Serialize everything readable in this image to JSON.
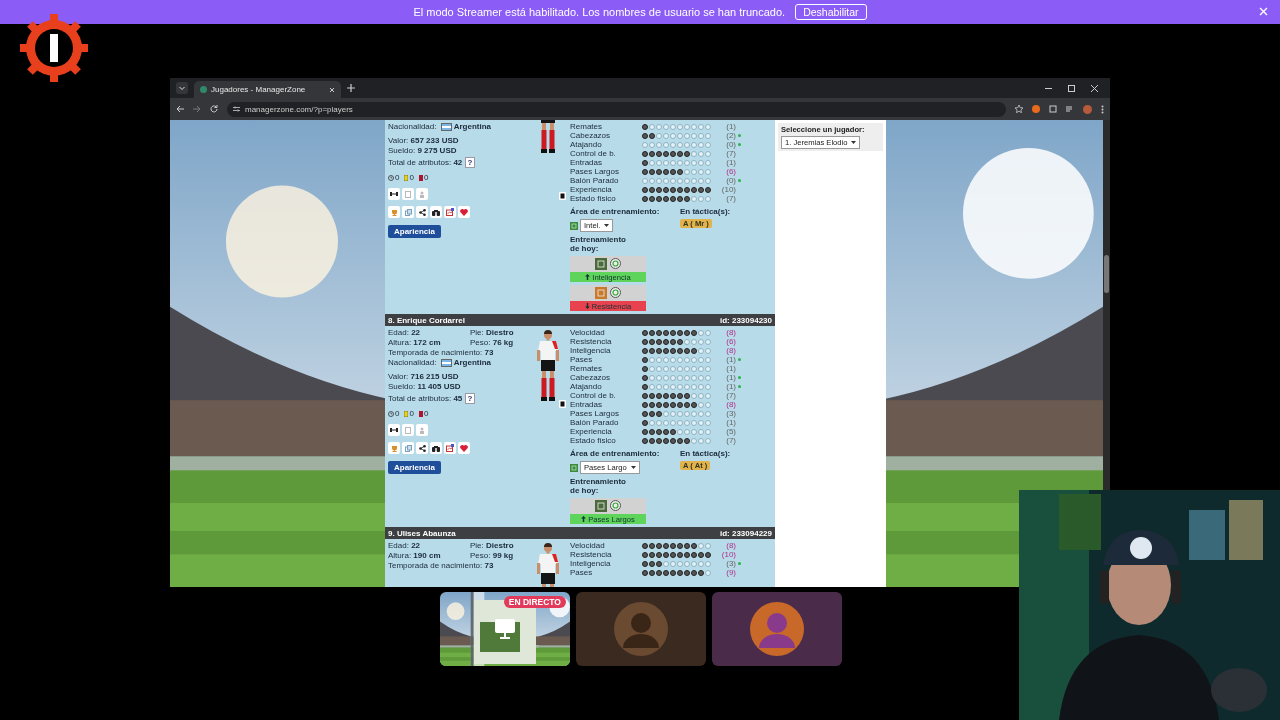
{
  "banner": {
    "text": "El modo Streamer está habilitado. Los nombres de usuario se han truncado.",
    "button": "Deshabilitar"
  },
  "browser": {
    "tab_title": "Jugadores - ManagerZone",
    "url": "managerzone.com/?p=players"
  },
  "players": [
    {
      "info_rows": [
        [
          {
            "label": "Nacionalidad:",
            "value": "Argentina",
            "flag": true
          }
        ]
      ],
      "money_rows": [
        {
          "label": "Valor:",
          "value": "657 233 USD"
        },
        {
          "label": "Sueldo:",
          "value": "9 275 USD"
        }
      ],
      "total": {
        "label": "Total de atributos:",
        "value": "42",
        "help": "?"
      },
      "cards": [
        {
          "kind": "clock",
          "count": "0"
        },
        {
          "kind": "yellow",
          "count": "0"
        },
        {
          "kind": "red",
          "count": "0"
        }
      ],
      "appearance_button": "Apariencia",
      "skills": [
        {
          "name": "Remates",
          "stars": 1,
          "value": "(1)",
          "maxed": false,
          "dot": false
        },
        {
          "name": "Cabezazos",
          "stars": 2,
          "value": "(2)",
          "maxed": false,
          "dot": true
        },
        {
          "name": "Atajando",
          "stars": 0,
          "value": "(0)",
          "maxed": false,
          "dot": true
        },
        {
          "name": "Control de b.",
          "stars": 7,
          "value": "(7)",
          "maxed": false,
          "dot": false
        },
        {
          "name": "Entradas",
          "stars": 1,
          "value": "(1)",
          "maxed": false,
          "dot": false
        },
        {
          "name": "Pases Largos",
          "stars": 6,
          "value": "(6)",
          "maxed": true,
          "dot": false
        },
        {
          "name": "Balón Parado",
          "stars": 0,
          "value": "(0)",
          "maxed": false,
          "dot": true
        },
        {
          "name": "Experiencia",
          "stars": 10,
          "value": "(10)",
          "maxed": false,
          "dot": false
        },
        {
          "name": "Estado físico",
          "stars": 7,
          "value": "(7)",
          "maxed": false,
          "dot": false
        }
      ],
      "training": {
        "area_label": "Área de entrenamiento:",
        "area": "Intel.",
        "tactics_label": "En táctica(s):",
        "tactic": "A ( Mr )",
        "today_label": "Entrenamiento de hoy:",
        "today": [
          {
            "skill": "Inteligencia",
            "kind": "up"
          },
          {
            "skill": "Resistencia",
            "kind": "down"
          }
        ]
      }
    },
    {
      "header": {
        "name": "8. Enrique Cordarrel",
        "id": "id: 233094230"
      },
      "info_rows": [
        [
          {
            "label": "Edad:",
            "value": "22"
          },
          {
            "label": "Pie:",
            "value": "Diestro"
          }
        ],
        [
          {
            "label": "Altura:",
            "value": "172 cm"
          },
          {
            "label": "Peso:",
            "value": "76 kg"
          }
        ],
        [
          {
            "label": "Temporada de nacimiento:",
            "value": "73"
          }
        ],
        [
          {
            "label": "Nacionalidad:",
            "value": "Argentina",
            "flag": true
          }
        ]
      ],
      "money_rows": [
        {
          "label": "Valor:",
          "value": "716 215 USD"
        },
        {
          "label": "Sueldo:",
          "value": "11 405 USD"
        }
      ],
      "total": {
        "label": "Total de atributos:",
        "value": "45",
        "help": "?"
      },
      "cards": [
        {
          "kind": "clock",
          "count": "0"
        },
        {
          "kind": "yellow",
          "count": "0"
        },
        {
          "kind": "red",
          "count": "0"
        }
      ],
      "appearance_button": "Apariencia",
      "skills": [
        {
          "name": "Velocidad",
          "stars": 8,
          "value": "(8)",
          "maxed": true,
          "dot": false
        },
        {
          "name": "Resistencia",
          "stars": 6,
          "value": "(6)",
          "maxed": true,
          "dot": false
        },
        {
          "name": "Inteligencia",
          "stars": 8,
          "value": "(8)",
          "maxed": true,
          "dot": false
        },
        {
          "name": "Pases",
          "stars": 1,
          "value": "(1)",
          "maxed": false,
          "dot": true
        },
        {
          "name": "Remates",
          "stars": 1,
          "value": "(1)",
          "maxed": false,
          "dot": false
        },
        {
          "name": "Cabezazos",
          "stars": 1,
          "value": "(1)",
          "maxed": false,
          "dot": true
        },
        {
          "name": "Atajando",
          "stars": 1,
          "value": "(1)",
          "maxed": false,
          "dot": true
        },
        {
          "name": "Control de b.",
          "stars": 7,
          "value": "(7)",
          "maxed": false,
          "dot": false
        },
        {
          "name": "Entradas",
          "stars": 8,
          "value": "(8)",
          "maxed": true,
          "dot": false
        },
        {
          "name": "Pases Largos",
          "stars": 3,
          "value": "(3)",
          "maxed": false,
          "dot": false
        },
        {
          "name": "Balón Parado",
          "stars": 1,
          "value": "(1)",
          "maxed": false,
          "dot": false
        },
        {
          "name": "Experiencia",
          "stars": 5,
          "value": "(5)",
          "maxed": false,
          "dot": false
        },
        {
          "name": "Estado físico",
          "stars": 7,
          "value": "(7)",
          "maxed": false,
          "dot": false
        }
      ],
      "training": {
        "area_label": "Área de entrenamiento:",
        "area": "Pases Largo",
        "tactics_label": "En táctica(s):",
        "tactic": "A ( At )",
        "today_label": "Entrenamiento de hoy:",
        "today": [
          {
            "skill": "Pases Largos",
            "kind": "up"
          }
        ]
      }
    },
    {
      "header": {
        "name": "9. Ulises Abaunza",
        "id": "id: 233094229"
      },
      "info_rows": [
        [
          {
            "label": "Edad:",
            "value": "22"
          },
          {
            "label": "Pie:",
            "value": "Diestro"
          }
        ],
        [
          {
            "label": "Altura:",
            "value": "190 cm"
          },
          {
            "label": "Peso:",
            "value": "99 kg"
          }
        ],
        [
          {
            "label": "Temporada de nacimiento:",
            "value": "73"
          }
        ]
      ],
      "skills": [
        {
          "name": "Velocidad",
          "stars": 8,
          "value": "(8)",
          "maxed": true,
          "dot": false
        },
        {
          "name": "Resistencia",
          "stars": 10,
          "value": "(10)",
          "maxed": true,
          "dot": false
        },
        {
          "name": "Inteligencia",
          "stars": 3,
          "value": "(3)",
          "maxed": false,
          "dot": true
        },
        {
          "name": "Pases",
          "stars": 9,
          "value": "(9)",
          "maxed": true,
          "dot": false
        }
      ]
    }
  ],
  "player_select": {
    "label": "Seleccione un jugador:",
    "value": "1. Jeremias Elodio"
  },
  "thumbnails": [
    {
      "kind": "screen",
      "badge": "EN DIRECTO"
    },
    {
      "kind": "avatar",
      "color": "#3a2a20"
    },
    {
      "kind": "avatar",
      "color": "#4a2c4a"
    }
  ]
}
